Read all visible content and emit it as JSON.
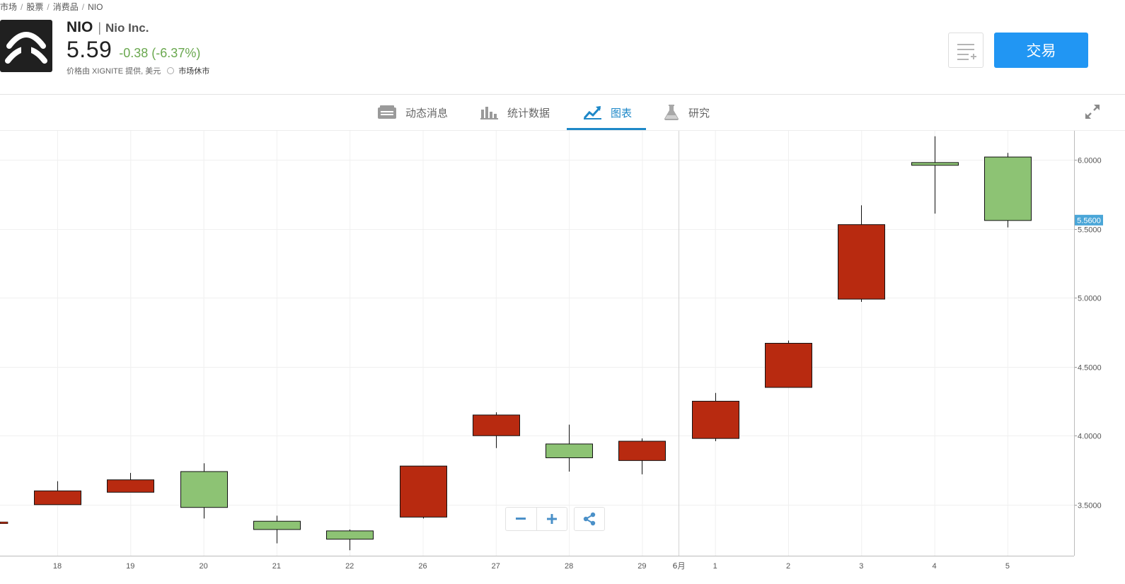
{
  "breadcrumb": [
    "市场",
    "股票",
    "消费品",
    "NIO"
  ],
  "header": {
    "ticker": "NIO",
    "company": "Nio Inc.",
    "price": "5.59",
    "change": "-0.38 (-6.37%)",
    "source": "价格由 XIGNITE 提供, 美元",
    "market_status": "市场休市",
    "trade_label": "交易"
  },
  "tabs": [
    {
      "label": "动态消息",
      "icon": "newspaper-icon"
    },
    {
      "label": "统计数据",
      "icon": "bar-stats-icon"
    },
    {
      "label": "图表",
      "icon": "chart-trend-icon",
      "active": true
    },
    {
      "label": "研究",
      "icon": "flask-icon"
    }
  ],
  "colors": {
    "up": "#b82a10",
    "down": "#8dc374",
    "accent": "#1e88c8",
    "button": "#2196f3",
    "price_tag": "#4aa6d8"
  },
  "chart_data": {
    "type": "candlestick",
    "categories": [
      "18",
      "19",
      "20",
      "21",
      "22",
      "26",
      "27",
      "28",
      "29",
      "1",
      "2",
      "3",
      "4",
      "5"
    ],
    "month_marker": "6月",
    "candles": [
      {
        "x": "18",
        "open": 3.5,
        "high": 3.67,
        "low": 3.5,
        "close": 3.6
      },
      {
        "x": "19",
        "open": 3.59,
        "high": 3.73,
        "low": 3.59,
        "close": 3.68
      },
      {
        "x": "20",
        "open": 3.74,
        "high": 3.8,
        "low": 3.4,
        "close": 3.48
      },
      {
        "x": "21",
        "open": 3.38,
        "high": 3.42,
        "low": 3.22,
        "close": 3.32
      },
      {
        "x": "22",
        "open": 3.31,
        "high": 3.32,
        "low": 3.17,
        "close": 3.25
      },
      {
        "x": "26",
        "open": 3.41,
        "high": 3.78,
        "low": 3.4,
        "close": 3.78
      },
      {
        "x": "27",
        "open": 4.0,
        "high": 4.17,
        "low": 3.91,
        "close": 4.15
      },
      {
        "x": "28",
        "open": 3.94,
        "high": 4.08,
        "low": 3.74,
        "close": 3.84
      },
      {
        "x": "29",
        "open": 3.82,
        "high": 3.98,
        "low": 3.72,
        "close": 3.96
      },
      {
        "x": "1",
        "open": 3.98,
        "high": 4.31,
        "low": 3.96,
        "close": 4.25
      },
      {
        "x": "2",
        "open": 4.35,
        "high": 4.69,
        "low": 4.35,
        "close": 4.67
      },
      {
        "x": "3",
        "open": 4.99,
        "high": 5.67,
        "low": 4.97,
        "close": 5.53
      },
      {
        "x": "4",
        "open": 5.98,
        "high": 6.17,
        "low": 5.61,
        "close": 5.96
      },
      {
        "x": "5",
        "open": 6.02,
        "high": 6.05,
        "low": 5.51,
        "close": 5.56
      }
    ],
    "partial_left": {
      "value": 3.37
    },
    "last_price": "5.5600",
    "y_ticks": [
      "3.5000",
      "4.0000",
      "4.5000",
      "5.0000",
      "5.5000",
      "6.0000"
    ],
    "ylim": [
      3.13,
      6.21
    ],
    "grid": true
  }
}
